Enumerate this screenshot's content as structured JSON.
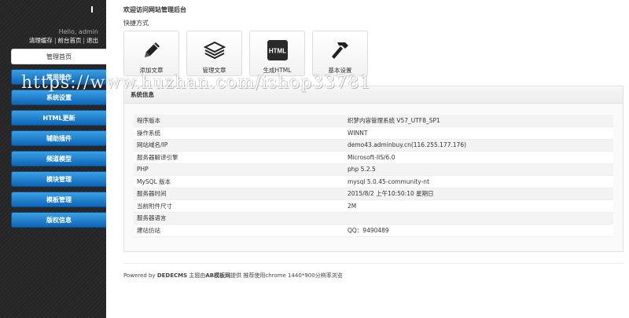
{
  "sidebar": {
    "greeting": "Hello, admin",
    "links": [
      "清理缓存",
      "前台首页",
      "退出"
    ],
    "nav": [
      "管理首页",
      "常用操作",
      "系统设置",
      "HTML更新",
      "辅助插件",
      "频道模型",
      "模块管理",
      "模板管理",
      "版权信息"
    ],
    "accent": "#1a7fd1"
  },
  "main": {
    "welcome": "欢迎访问网站管理后台",
    "quick_label": "快捷方式",
    "quick": [
      {
        "label": "添加文章",
        "icon": "pencil-icon"
      },
      {
        "label": "管理文章",
        "icon": "stack-icon"
      },
      {
        "label": "生成HTML",
        "icon": "html-icon",
        "badge": "HTML"
      },
      {
        "label": "基本设置",
        "icon": "hammer-icon"
      }
    ],
    "panel_title": "系统信息",
    "rows": [
      [
        "程序版本",
        "织梦内容管理系统 V57_UTF8_SP1"
      ],
      [
        "操作系统",
        "WINNT"
      ],
      [
        "网站域名/IP",
        "demo43.adminbuy.cn(116.255.177.176)"
      ],
      [
        "服务器解译引擎",
        "Microsoft-IIS/6.0"
      ],
      [
        "PHP",
        "php 5.2.5"
      ],
      [
        "MySQL 版本",
        "mysql 5.0.45-community-nt"
      ],
      [
        "服务器时间",
        "2015/8/2 上午10:50:10 星期日"
      ],
      [
        "当前附件尺寸",
        "2M"
      ],
      [
        "服务器语言",
        ""
      ],
      [
        "建站仿站",
        "QQ：9490489"
      ]
    ],
    "footer": {
      "powered": "Powered by",
      "brand": "DEDECMS",
      "mid": " 主题由",
      "brand2": "AB模板网",
      "rest": "提供 推荐使用chrome 1440*900分辨率浏览"
    }
  },
  "watermark": "https://www.huzhan.com/ishop33781"
}
